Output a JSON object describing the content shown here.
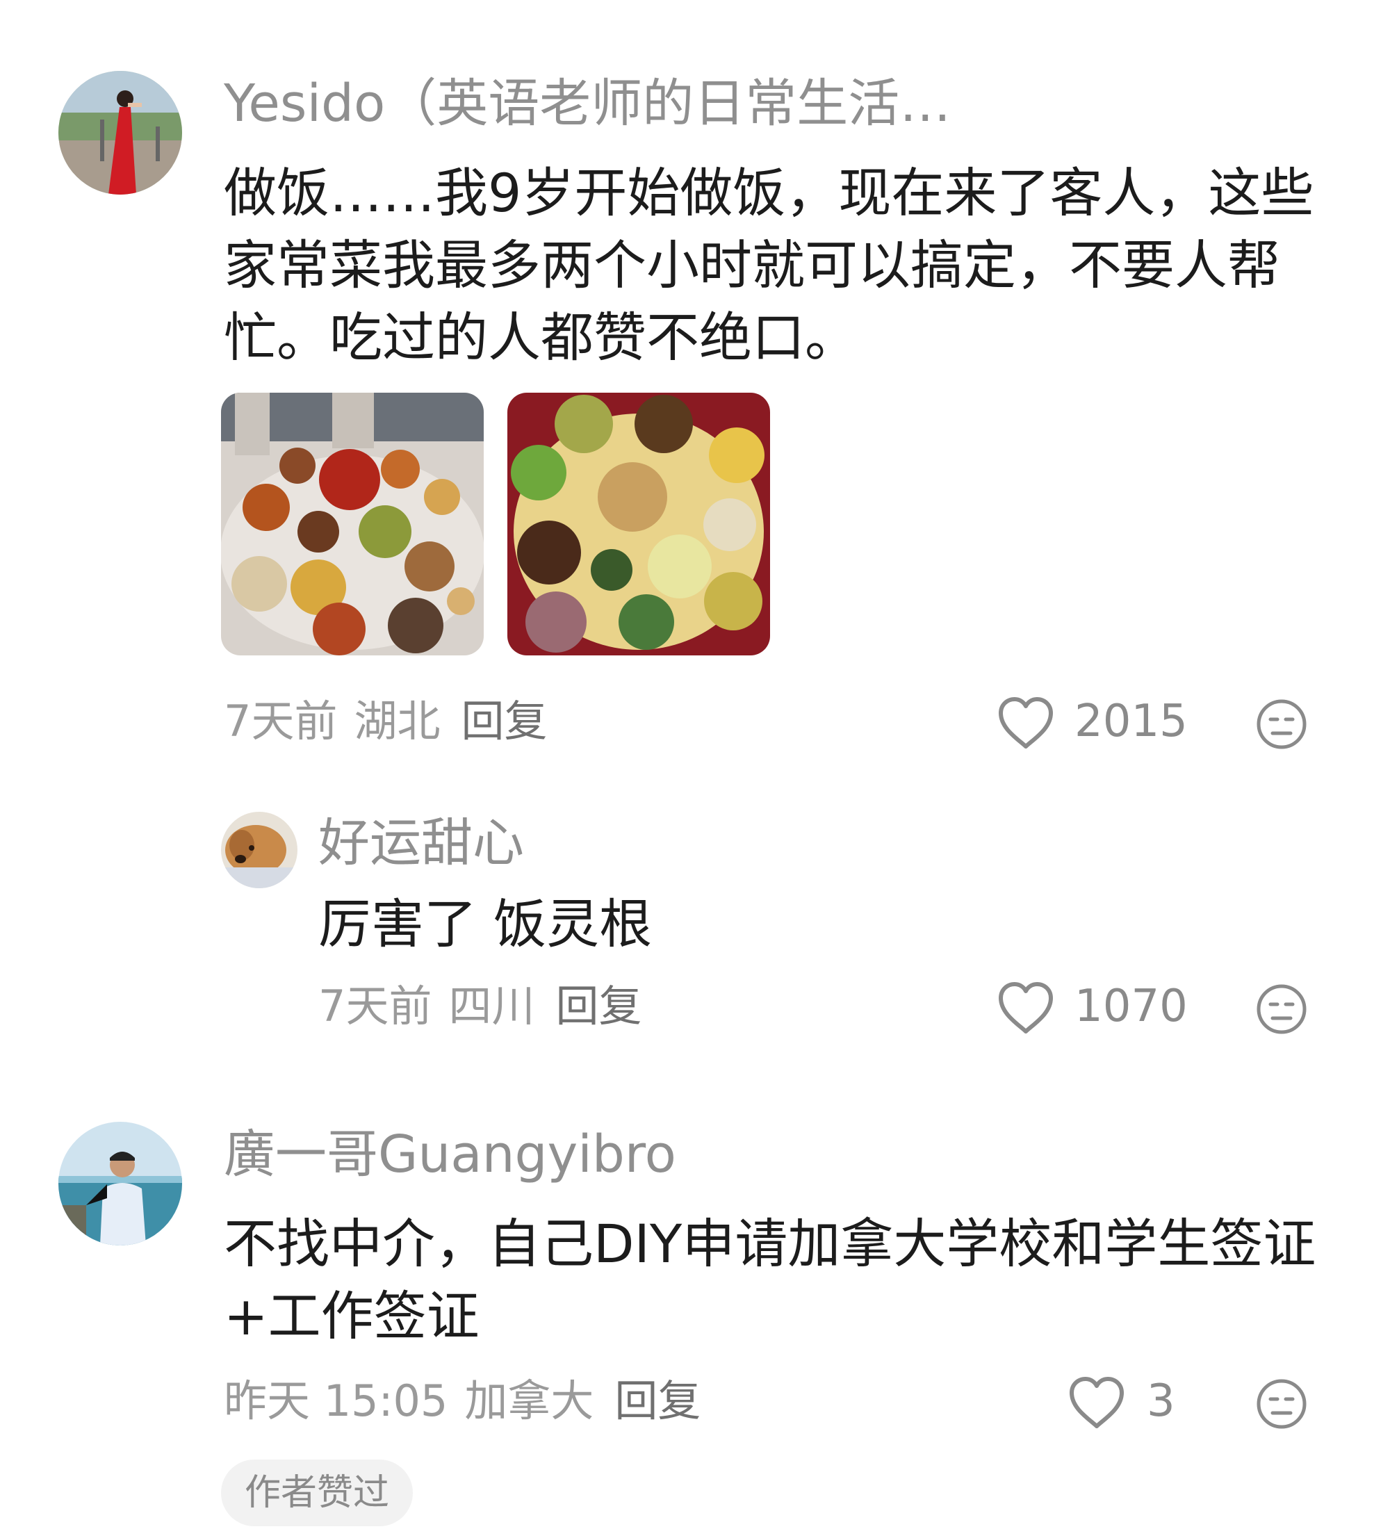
{
  "comments": [
    {
      "author": "Yesido（英语老师的日常生活…",
      "text": "做饭……我9岁开始做饭，现在来了客人，这些家常菜我最多两个小时就可以搞定，不要人帮忙。吃过的人都赞不绝口。",
      "time": "7天前",
      "location": "湖北",
      "reply_label": "回复",
      "likes": "2015",
      "reply": {
        "author": "好运甜心",
        "text": "厉害了 饭灵根",
        "time": "7天前",
        "location": "四川",
        "reply_label": "回复",
        "likes": "1070"
      }
    },
    {
      "author": "廣一哥Guangyibro",
      "text": "不找中介，自己DIY申请加拿大学校和学生签证+工作签证",
      "time": "昨天 15:05",
      "location": "加拿大",
      "reply_label": "回复",
      "likes": "3",
      "badge": "作者赞过"
    }
  ],
  "icons": {
    "like": "heart-outline-icon",
    "dislike": "meh-face-icon"
  }
}
